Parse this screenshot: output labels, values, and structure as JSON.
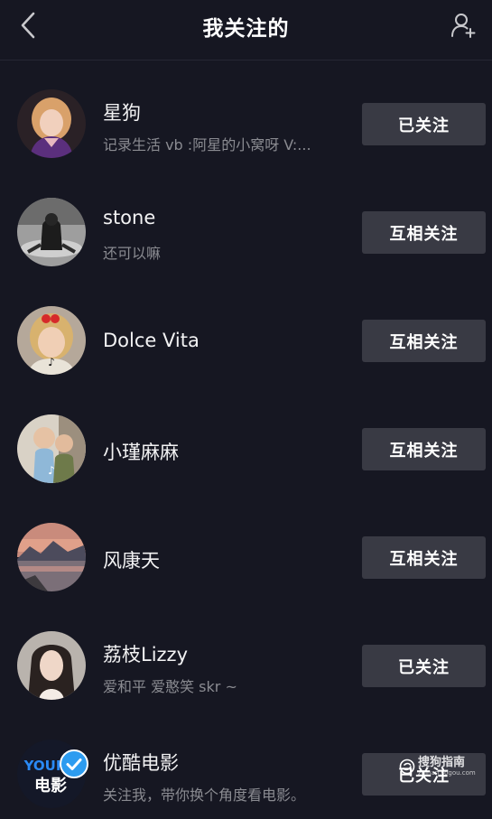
{
  "header": {
    "title": "我关注的",
    "back_icon": "chevron-left-icon",
    "add_icon": "add-user-icon"
  },
  "users": [
    {
      "name": "星狗",
      "signature": "记录生活 vb :阿星的小窝呀 V:...",
      "button": "已关注"
    },
    {
      "name": "stone",
      "signature": "还可以嘛",
      "button": "互相关注"
    },
    {
      "name": "Dolce Vita",
      "signature": "",
      "button": "互相关注"
    },
    {
      "name": "小瑾麻麻",
      "signature": "",
      "button": "互相关注"
    },
    {
      "name": "风康天",
      "signature": "",
      "button": "互相关注"
    },
    {
      "name": "荔枝Lizzy",
      "signature": "爱和平 爱憨笑 skr ~",
      "button": "已关注"
    },
    {
      "name": "优酷电影",
      "signature": "关注我，带你换个角度看电影。",
      "button": "已关注",
      "avatar_text": "YOUKU",
      "avatar_subtext": "电影"
    }
  ],
  "watermark": {
    "text": "搜狗指南",
    "subtext": "zhinan.sogou.com"
  },
  "colors": {
    "background": "#161722",
    "button": "#393a44",
    "secondary_text": "#8a8b91",
    "verified": "#2d9cf0"
  }
}
